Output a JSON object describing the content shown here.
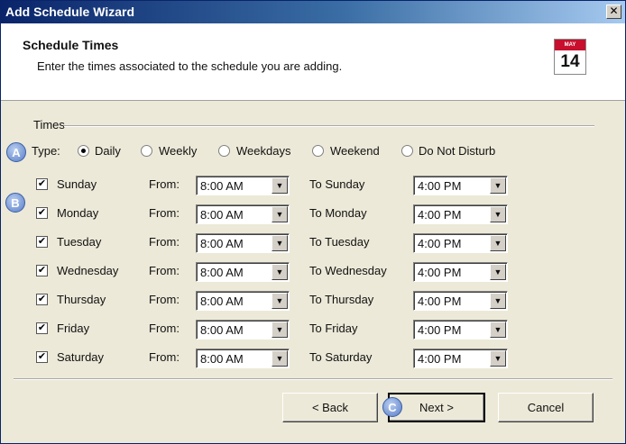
{
  "window": {
    "title": "Add Schedule Wizard",
    "close_glyph": "✕"
  },
  "header": {
    "title": "Schedule Times",
    "subtitle": "Enter the times associated to the schedule you are adding.",
    "calendar_icon": {
      "name": "calendar-icon",
      "month": "MAY",
      "day": "14"
    }
  },
  "group": {
    "label": "Times"
  },
  "badges": {
    "a": "A",
    "b": "B",
    "c": "C"
  },
  "type": {
    "label": "Type:",
    "options": [
      "Daily",
      "Weekly",
      "Weekdays",
      "Weekend",
      "Do Not Disturb"
    ],
    "selected": "Daily"
  },
  "days": [
    {
      "name": "Sunday",
      "from_label": "From:",
      "from": "8:00 AM",
      "to_label": "To Sunday",
      "to": "4:00 PM",
      "checked": "✔"
    },
    {
      "name": "Monday",
      "from_label": "From:",
      "from": "8:00 AM",
      "to_label": "To Monday",
      "to": "4:00 PM",
      "checked": "✔"
    },
    {
      "name": "Tuesday",
      "from_label": "From:",
      "from": "8:00 AM",
      "to_label": "To Tuesday",
      "to": "4:00 PM",
      "checked": "✔"
    },
    {
      "name": "Wednesday",
      "from_label": "From:",
      "from": "8:00 AM",
      "to_label": "To Wednesday",
      "to": "4:00 PM",
      "checked": "✔"
    },
    {
      "name": "Thursday",
      "from_label": "From:",
      "from": "8:00 AM",
      "to_label": "To Thursday",
      "to": "4:00 PM",
      "checked": "✔"
    },
    {
      "name": "Friday",
      "from_label": "From:",
      "from": "8:00 AM",
      "to_label": "To Friday",
      "to": "4:00 PM",
      "checked": "✔"
    },
    {
      "name": "Saturday",
      "from_label": "From:",
      "from": "8:00 AM",
      "to_label": "To Saturday",
      "to": "4:00 PM",
      "checked": "✔"
    }
  ],
  "dropdown_arrow": "▼",
  "buttons": {
    "back": "< Back",
    "next": "Next >",
    "cancel": "Cancel"
  }
}
